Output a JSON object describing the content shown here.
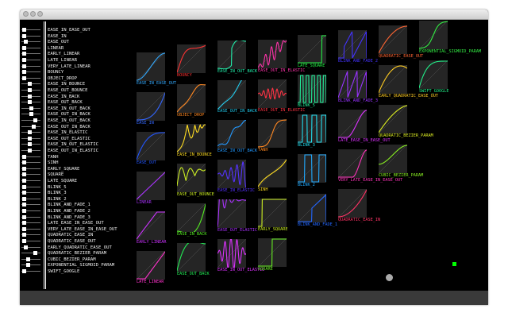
{
  "easings": [
    {
      "name": "EASE_IN_EASE_OUT",
      "color": "#33aaff",
      "knob": 0.05
    },
    {
      "name": "EASE_IN",
      "color": "#3366ff",
      "knob": 0.05
    },
    {
      "name": "EASE_OUT",
      "color": "#2255ff",
      "knob": 0.1
    },
    {
      "name": "LINEAR",
      "color": "#aa33ff",
      "knob": 0.05
    },
    {
      "name": "EARLY_LINEAR",
      "color": "#cc33ff",
      "knob": 0.05
    },
    {
      "name": "LATE_LINEAR",
      "color": "#ff33cc",
      "knob": 0.05
    },
    {
      "name": "VERY_LATE_LINEAR",
      "color": "#ff3377",
      "knob": 0.05
    },
    {
      "name": "BOUNCY",
      "color": "#ff3333",
      "knob": 0.05
    },
    {
      "name": "OBJECT_DROP",
      "color": "#ff8822",
      "knob": 0.05
    },
    {
      "name": "EASE_IN_BOUNCE",
      "color": "#ffdd22",
      "knob": 0.3
    },
    {
      "name": "EASE_OUT_BOUNCE",
      "color": "#ccee22",
      "knob": 0.3
    },
    {
      "name": "EASE_IN_BACK",
      "color": "#55ee22",
      "knob": 0.3
    },
    {
      "name": "EASE_OUT_BACK",
      "color": "#22ee55",
      "knob": 0.3
    },
    {
      "name": "EASE_IN_OUT_BACK",
      "color": "#22eeaa",
      "knob": 0.35
    },
    {
      "name": "EASE_OUT_IN_BACK",
      "color": "#22ccee",
      "knob": 0.35
    },
    {
      "name": "EASE_IN_OUT_BACK",
      "color": "#2299ff",
      "knob": 0.55
    },
    {
      "name": "EASE_OUT_IN_BACK",
      "color": "#2266ff",
      "knob": 0.45
    },
    {
      "name": "EASE_IN_ELASTIC",
      "color": "#5533ff",
      "knob": 0.3
    },
    {
      "name": "EASE_OUT_ELASTIC",
      "color": "#aa33ff",
      "knob": 0.3
    },
    {
      "name": "EASE_IN_OUT_ELASTIC",
      "color": "#dd33ff",
      "knob": 0.3
    },
    {
      "name": "EASE_OUT_IN_ELASTIC",
      "color": "#ff33aa",
      "knob": 0.3
    },
    {
      "name": "TANH",
      "color": "#ff3344",
      "knob": 0.05
    },
    {
      "name": "SINH",
      "color": "#ff8822",
      "knob": 0.05
    },
    {
      "name": "EARLY_SQUARE",
      "color": "#ffdd22",
      "knob": 0.05
    },
    {
      "name": "SQUARE",
      "color": "#66ee22",
      "knob": 0.05
    },
    {
      "name": "LATE_SQUARE",
      "color": "#22ee44",
      "knob": 0.05
    },
    {
      "name": "BLINK_5",
      "color": "#22ee99",
      "knob": 0.05
    },
    {
      "name": "BLINK_3",
      "color": "#22ddee",
      "knob": 0.05
    },
    {
      "name": "BLINK_2",
      "color": "#22aaff",
      "knob": 0.05
    },
    {
      "name": "BLINK_AND_FADE_1",
      "color": "#2266ff",
      "knob": 0.05
    },
    {
      "name": "BLINK_AND_FADE_2",
      "color": "#4433ff",
      "knob": 0.05
    },
    {
      "name": "BLINK_AND_FADE_3",
      "color": "#9933ff",
      "knob": 0.05
    },
    {
      "name": "LATE_EASE_IN_EASE_OUT",
      "color": "#dd33ff",
      "knob": 0.05
    },
    {
      "name": "VERY_LATE_EASE_IN_EASE_OUT",
      "color": "#ff33bb",
      "knob": 0.05
    },
    {
      "name": "QUADRATIC_EASE_IN",
      "color": "#ff3366",
      "knob": 0.05
    },
    {
      "name": "QUADRATIC_EASE_OUT",
      "color": "#ff6633",
      "knob": 0.05
    },
    {
      "name": "EARLY_QUADRATIC_EASE_OUT",
      "color": "#ffbb22",
      "knob": 0.1
    },
    {
      "name": "QUADRATIC_BEZIER_PARAM",
      "color": "#ddee22",
      "knob": 0.55
    },
    {
      "name": "CUBIC_BEZIER_PARAM",
      "color": "#88ee22",
      "knob": 0.2
    },
    {
      "name": "EXPONENTIAL_SIGMOID_PARAM",
      "color": "#33ee44",
      "knob": 0.2
    },
    {
      "name": "SWIFT_GOOGLE",
      "color": "#22ee88",
      "knob": 0.05
    }
  ],
  "tiles": [
    {
      "label": "EASE_IN_EASE_OUT",
      "color": "#33aaff",
      "fn": "smooth"
    },
    {
      "label": "EASE_IN",
      "color": "#3366ff",
      "fn": "easein"
    },
    {
      "label": "EASE_OUT",
      "color": "#2255ff",
      "fn": "easeout"
    },
    {
      "label": "LINEAR",
      "color": "#aa33ff",
      "fn": "linear"
    },
    {
      "label": "EARLY_LINEAR",
      "color": "#cc33ff",
      "fn": "early"
    },
    {
      "label": "LATE_LINEAR",
      "color": "#ff33cc",
      "fn": "late"
    },
    {
      "label": "VERY_LATE_LINEAR",
      "color": "#ff3377",
      "fn": "verylate"
    },
    {
      "label": "BOUNCY",
      "color": "#ff3333",
      "fn": "bouncy"
    },
    {
      "label": "OBJECT_DROP",
      "color": "#ff8822",
      "fn": "drop"
    },
    {
      "label": "EASE_IN_BOUNCE",
      "color": "#ffdd22",
      "fn": "inbounce"
    },
    {
      "label": "EASE_OUT_BOUNCE",
      "color": "#ccee22",
      "fn": "outbounce"
    },
    {
      "label": "EASE_IN_BACK",
      "color": "#55ee22",
      "fn": "inback"
    },
    {
      "label": "EASE_OUT_BACK",
      "color": "#22ee55",
      "fn": "outback"
    },
    {
      "label": "EASE_IN_OUT_BACK",
      "color": "#22eeaa",
      "fn": "inoutback"
    },
    {
      "label": "EASE_OUT_IN_BACK",
      "color": "#22ccee",
      "fn": "outinback"
    },
    {
      "label": "EASE_IN_OUT_BACK",
      "color": "#2299ff",
      "fn": "inoutback2"
    },
    {
      "label": "EASE_IN_ELASTIC",
      "color": "#5533ff",
      "fn": "inelastic"
    },
    {
      "label": "EASE_OUT_ELASTIC",
      "color": "#aa33ff",
      "fn": "outelastic"
    },
    {
      "label": "EASE_IN_OUT_ELASTIC",
      "color": "#dd33ff",
      "fn": "inoutelastic"
    },
    {
      "label": "EASE_OUT_IN_ELASTIC",
      "color": "#ff33aa",
      "fn": "outinelastic"
    },
    {
      "label": "EASE_OUT_IN_ELASTIC",
      "color": "#ff3344",
      "fn": "outinelastic2"
    },
    {
      "label": "TANH",
      "color": "#ff8822",
      "fn": "tanh"
    },
    {
      "label": "SINH",
      "color": "#ffdd22",
      "fn": "sinh"
    },
    {
      "label": "EARLY_SQUARE",
      "color": "#ccee22",
      "fn": "earlysq"
    },
    {
      "label": "SQUARE",
      "color": "#66ee22",
      "fn": "square"
    },
    {
      "label": "LATE_SQUARE",
      "color": "#22ee44",
      "fn": "latesq"
    },
    {
      "label": "BLINK_5",
      "color": "#22ee99",
      "fn": "blink5"
    },
    {
      "label": "BLINK_3",
      "color": "#22ddee",
      "fn": "blink3"
    },
    {
      "label": "BLINK_2",
      "color": "#22aaff",
      "fn": "blink2"
    },
    {
      "label": "BLINK_AND_FADE_1",
      "color": "#2266ff",
      "fn": "bf1"
    },
    {
      "label": "BLINK_AND_FADE_2",
      "color": "#4433ff",
      "fn": "bf2"
    },
    {
      "label": "BLINK_AND_FADE_3",
      "color": "#9933ff",
      "fn": "bf3"
    },
    {
      "label": "LATE_EASE_IN_EASE_OUT",
      "color": "#dd33ff",
      "fn": "latesmooth"
    },
    {
      "label": "VERY_LATE_EASE_IN_EASE_OUT",
      "color": "#ff33bb",
      "fn": "verylatesmooth"
    },
    {
      "label": "QUADRATIC_EASE_IN",
      "color": "#ff3366",
      "fn": "quadin"
    },
    {
      "label": "QUADRATIC_EASE_OUT",
      "color": "#ff6633",
      "fn": "quadout"
    },
    {
      "label": "EARLY_QUADRATIC_EASE_OUT",
      "color": "#ffcc22",
      "fn": "earlyquadout"
    },
    {
      "label": "QUADRATIC_BEZIER_PARAM",
      "color": "#ddee22",
      "fn": "qbez"
    },
    {
      "label": "CUBIC_BEZIER_PARAM",
      "color": "#88ee22",
      "fn": "cbez"
    },
    {
      "label": "EXPONENTIAL_SIGMOID_PARAM",
      "color": "#33ee44",
      "fn": "expsig"
    },
    {
      "label": "SWIFT_GOOGLE",
      "color": "#22ee88",
      "fn": "swift"
    }
  ]
}
